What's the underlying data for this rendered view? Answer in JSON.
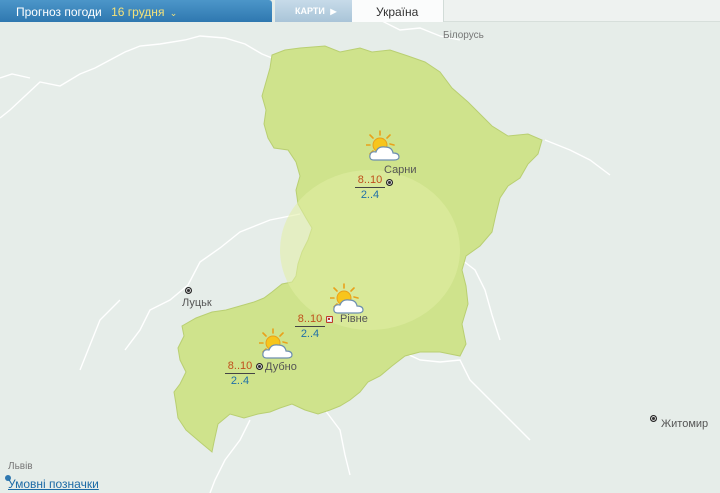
{
  "header": {
    "title": "Прогноз погоди",
    "date": "16 грудня",
    "date_caret": "⌄",
    "maps_tab": "КАРТИ",
    "maps_arrow": "▶",
    "region_tab": "Україна"
  },
  "map": {
    "labels": {
      "belarus": "Білорусь",
      "lutsk": "Луцьк",
      "lviv": "Львів",
      "zhytomyr": "Житомир"
    },
    "cities": [
      {
        "name": "Сарни",
        "day_temp": "8..10",
        "night_temp": "2..4",
        "icon": "partly-cloudy-icon"
      },
      {
        "name": "Рівне",
        "day_temp": "8..10",
        "night_temp": "2..4",
        "icon": "partly-cloudy-icon"
      },
      {
        "name": "Дубно",
        "day_temp": "8..10",
        "night_temp": "2..4",
        "icon": "partly-cloudy-icon"
      }
    ],
    "region_color": "#cfe38c",
    "background_color": "#e6ede9"
  },
  "footer": {
    "legend_link": "Умовні позначки"
  }
}
